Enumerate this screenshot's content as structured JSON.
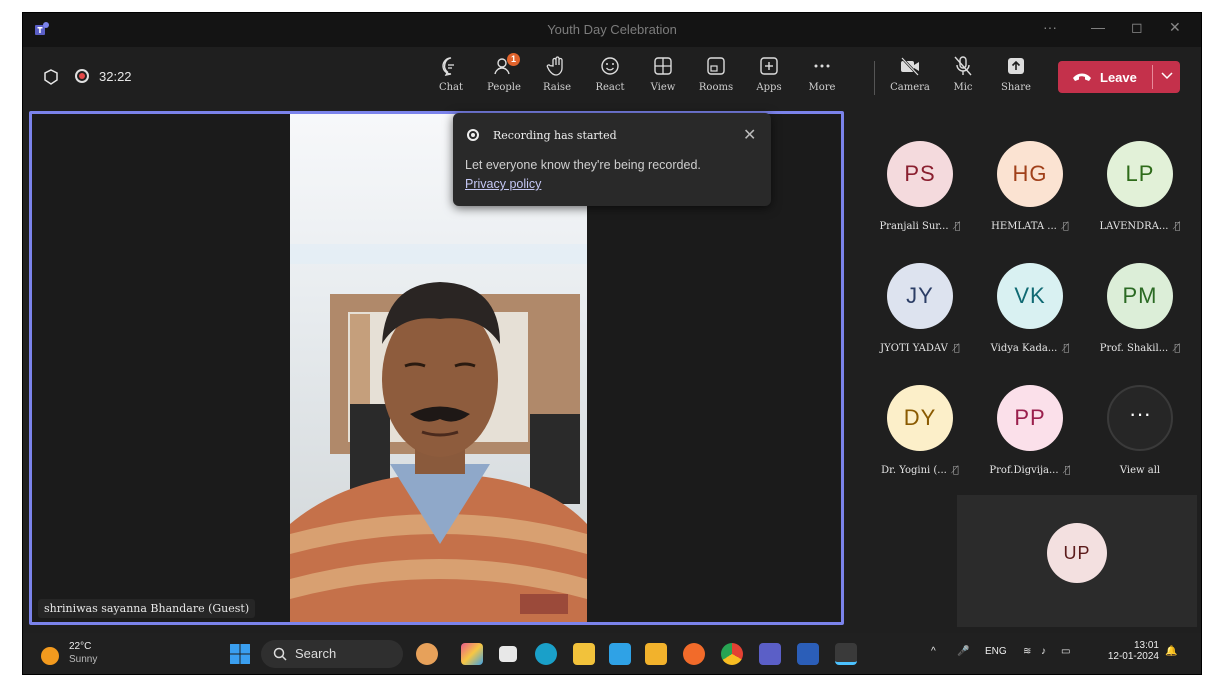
{
  "window": {
    "title": "Youth Day Celebration",
    "controls": [
      "···",
      "—",
      "◻",
      "✕"
    ]
  },
  "toolbar": {
    "timer": "32:22",
    "buttons": {
      "chat": "Chat",
      "people": "People",
      "people_badge": "1",
      "raise": "Raise",
      "react": "React",
      "view": "View",
      "rooms": "Rooms",
      "apps": "Apps",
      "more": "More",
      "camera": "Camera",
      "mic": "Mic",
      "share": "Share"
    },
    "leave_label": "Leave",
    "leave_color": "#c4314b"
  },
  "stage": {
    "speaker_name": "shriniwas sayanna Bhandare (Guest)",
    "border_color": "#7b83eb"
  },
  "notification": {
    "heading": "Recording has started",
    "body": "Let everyone know they're being recorded.",
    "link": "Privacy policy"
  },
  "participants": [
    {
      "initials": "PS",
      "name": "Pranjali Sur...",
      "bg": "#f4dadd",
      "fg": "#8a1f2f"
    },
    {
      "initials": "HG",
      "name": "HEMLATA ...",
      "bg": "#fbe3d2",
      "fg": "#a0401a"
    },
    {
      "initials": "LP",
      "name": "LAVENDRA...",
      "bg": "#e2f1d8",
      "fg": "#2e6b1a"
    },
    {
      "initials": "JY",
      "name": "JYOTI YADAV",
      "bg": "#dde3ef",
      "fg": "#2c3e66"
    },
    {
      "initials": "VK",
      "name": "Vidya Kada...",
      "bg": "#d9f1f2",
      "fg": "#106a73"
    },
    {
      "initials": "PM",
      "name": "Prof. Shakil...",
      "bg": "#dceed8",
      "fg": "#2b6a24"
    },
    {
      "initials": "DY",
      "name": "Dr. Yogini (...",
      "bg": "#fcefc9",
      "fg": "#8a5a00"
    },
    {
      "initials": "PP",
      "name": "Prof.Digvija...",
      "bg": "#fbe0ea",
      "fg": "#9a1f4d"
    }
  ],
  "view_all": {
    "label": "View all",
    "glyph": "···"
  },
  "self_view": {
    "initials": "UP"
  },
  "taskbar": {
    "temperature": "22°C",
    "condition": "Sunny",
    "search": "Search",
    "language": "ENG",
    "time": "13:01",
    "date": "12-01-2024"
  }
}
